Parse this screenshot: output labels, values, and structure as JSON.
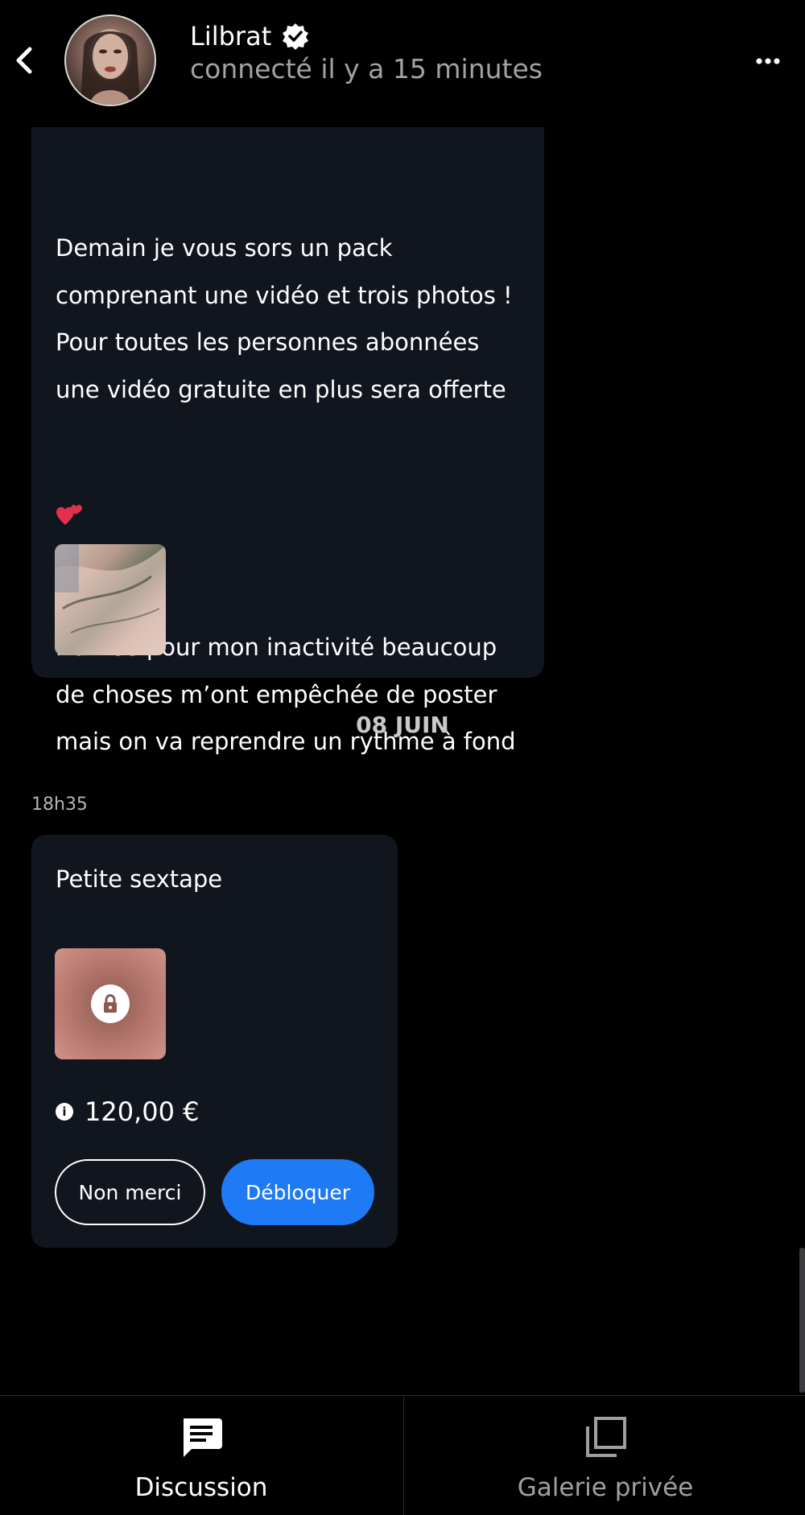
{
  "header": {
    "user_name": "Lilbrat",
    "presence": "connecté il y a 15 minutes",
    "back_icon": "chevron-left-icon",
    "verified_icon": "verified-badge-icon",
    "more_icon": "more-dots-icon"
  },
  "messages": {
    "first": {
      "paragraph_1": "Demain je vous sors un pack\ncomprenant une vidéo et trois photos !\nPour toutes les personnes abonnées\nune vidéo gratuite en plus sera offerte",
      "paragraph_2": "Navrée pour mon inactivité beaucoup\nde choses m’ont empêchée de poster\nmais on va reprendre un rythme à fond",
      "emoji": "two-hearts-icon"
    },
    "date_separator": "08 JUIN",
    "second": {
      "time": "18h35",
      "title": "Petite sextape",
      "price": "120,00 €",
      "lock_icon": "lock-icon",
      "info_icon": "info-icon",
      "decline_label": "Non merci",
      "unlock_label": "Débloquer"
    }
  },
  "bottom_nav": {
    "tabs": [
      {
        "label": "Discussion",
        "icon": "chat-icon",
        "active": true
      },
      {
        "label": "Galerie privée",
        "icon": "gallery-icon",
        "active": false
      }
    ]
  },
  "colors": {
    "background": "#000000",
    "bubble": "#11151d",
    "accent": "#1f7af5",
    "muted_text": "#a2a2a6"
  }
}
